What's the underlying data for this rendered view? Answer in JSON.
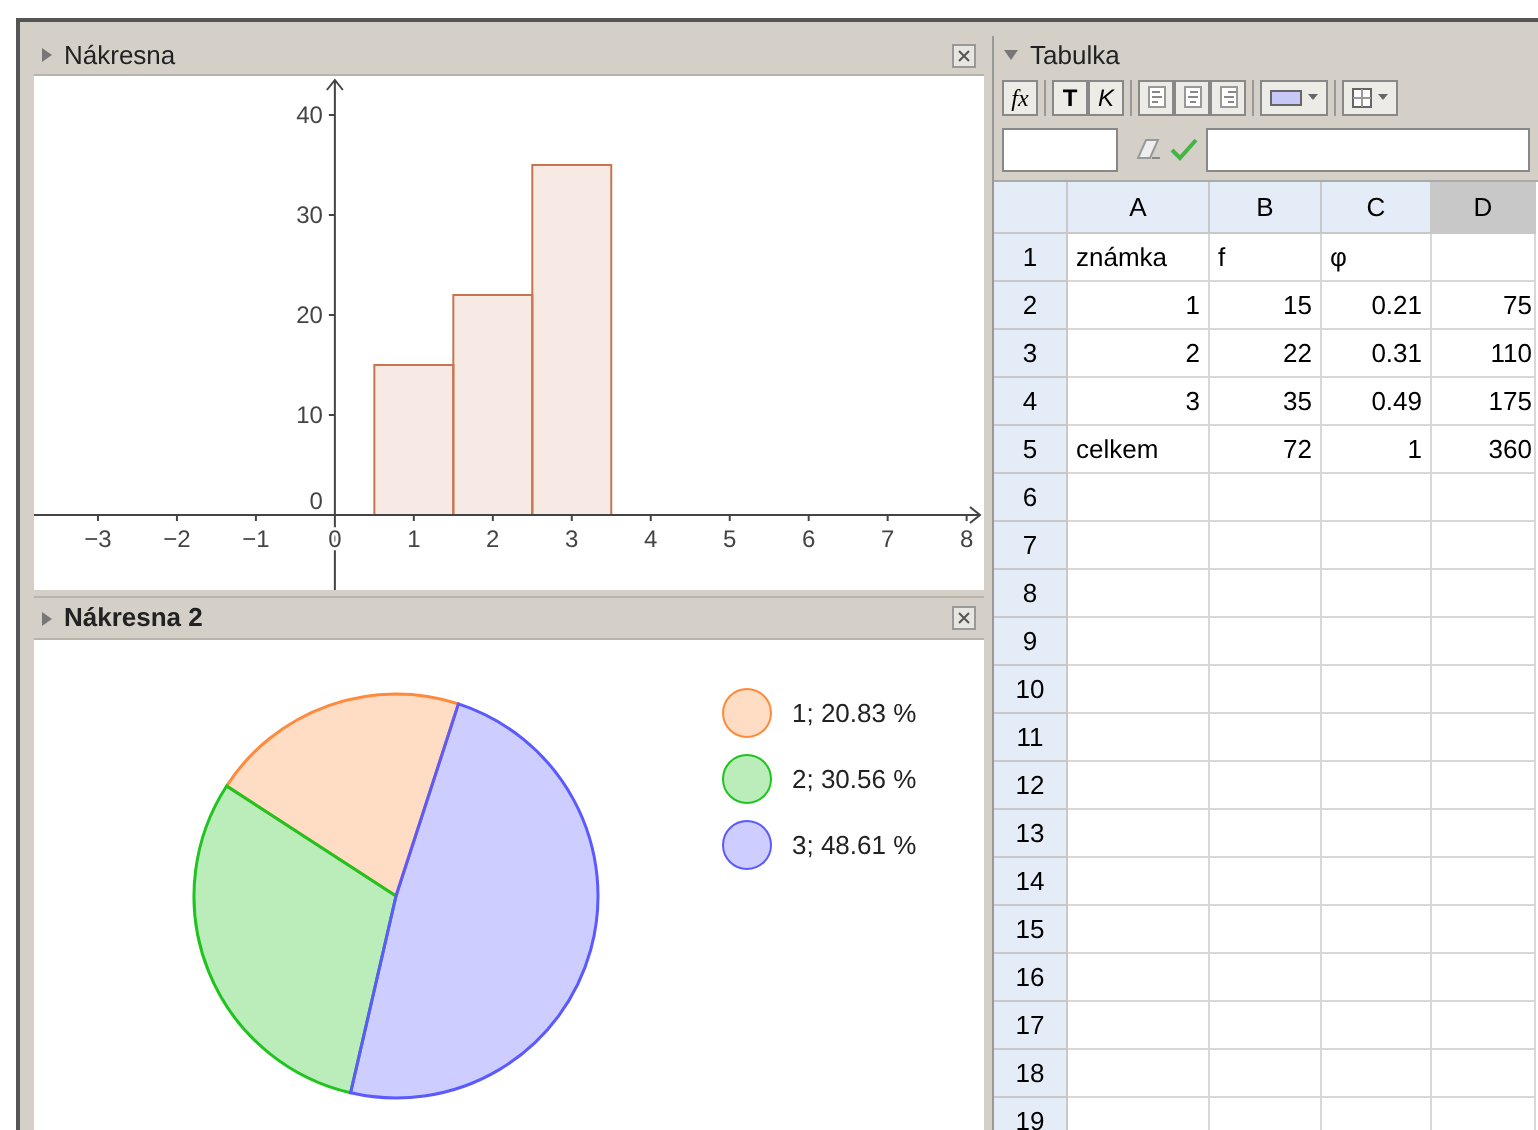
{
  "graphics_view": {
    "title": "Nákresna",
    "chart_data": {
      "type": "bar",
      "x": [
        1,
        2,
        3
      ],
      "values": [
        15,
        22,
        35
      ],
      "xlim": [
        -3.81,
        8.22
      ],
      "ylim": [
        -7.5,
        43.9
      ],
      "xticks": [
        {
          "value": -3,
          "label": "−3"
        },
        {
          "value": -2,
          "label": "−2"
        },
        {
          "value": -1,
          "label": "−1"
        },
        {
          "value": 0,
          "label": "0"
        },
        {
          "value": 1,
          "label": "1"
        },
        {
          "value": 2,
          "label": "2"
        },
        {
          "value": 3,
          "label": "3"
        },
        {
          "value": 4,
          "label": "4"
        },
        {
          "value": 5,
          "label": "5"
        },
        {
          "value": 6,
          "label": "6"
        },
        {
          "value": 7,
          "label": "7"
        },
        {
          "value": 8,
          "label": "8"
        }
      ],
      "yticks": [
        {
          "value": 0,
          "label": "0"
        },
        {
          "value": 10,
          "label": "10"
        },
        {
          "value": 20,
          "label": "20"
        },
        {
          "value": 30,
          "label": "30"
        },
        {
          "value": 40,
          "label": "40"
        }
      ]
    }
  },
  "graphics_view_2": {
    "title": "Nákresna 2",
    "chart_data": {
      "type": "pie",
      "categories": [
        "1; 20.83 %",
        "2; 30.56 %",
        "3; 48.61 %"
      ],
      "values": [
        20.83,
        30.56,
        48.61
      ],
      "legend": "right",
      "colors": [
        "#ff8a3c",
        "#1fc41f",
        "#5a5aff"
      ]
    }
  },
  "spreadsheet": {
    "title": "Tabulka",
    "toolbar": [
      {
        "kind": "formula",
        "label": "fx"
      },
      {
        "kind": "bold",
        "label": "T"
      },
      {
        "kind": "italic",
        "label": "K"
      },
      {
        "kind": "align-left"
      },
      {
        "kind": "align-center"
      },
      {
        "kind": "align-right"
      },
      {
        "kind": "color"
      },
      {
        "kind": "border"
      }
    ],
    "columns": [
      {
        "label": "A",
        "selected": false
      },
      {
        "label": "B",
        "selected": false
      },
      {
        "label": "C",
        "selected": false
      },
      {
        "label": "D",
        "selected": true
      }
    ],
    "rows": [
      {
        "label": "1",
        "cells": [
          {
            "kind": "text",
            "value": "známka"
          },
          {
            "kind": "text",
            "value": "f"
          },
          {
            "kind": "text",
            "value": "φ"
          }
        ]
      },
      {
        "label": "2",
        "cells": [
          {
            "kind": "number",
            "value": "1"
          },
          {
            "kind": "number",
            "value": "15"
          },
          {
            "kind": "number",
            "value": "0.21"
          },
          {
            "kind": "number",
            "value": "75"
          }
        ]
      },
      {
        "label": "3",
        "cells": [
          {
            "kind": "number",
            "value": "2"
          },
          {
            "kind": "number",
            "value": "22"
          },
          {
            "kind": "number",
            "value": "0.31"
          },
          {
            "kind": "number",
            "value": "110"
          }
        ]
      },
      {
        "label": "4",
        "cells": [
          {
            "kind": "number",
            "value": "3"
          },
          {
            "kind": "number",
            "value": "35"
          },
          {
            "kind": "number",
            "value": "0.49"
          },
          {
            "kind": "number",
            "value": "175"
          }
        ]
      },
      {
        "label": "5",
        "cells": [
          {
            "kind": "text",
            "value": "celkem"
          },
          {
            "kind": "number",
            "value": "72"
          },
          {
            "kind": "number",
            "value": "1"
          },
          {
            "kind": "number",
            "value": "360"
          }
        ]
      },
      {
        "label": "6"
      },
      {
        "label": "7"
      },
      {
        "label": "8"
      },
      {
        "label": "9"
      },
      {
        "label": "10"
      },
      {
        "label": "11"
      },
      {
        "label": "12"
      },
      {
        "label": "13"
      },
      {
        "label": "14"
      },
      {
        "label": "15"
      },
      {
        "label": "16"
      },
      {
        "label": "17"
      },
      {
        "label": "18"
      },
      {
        "label": "19"
      }
    ]
  }
}
